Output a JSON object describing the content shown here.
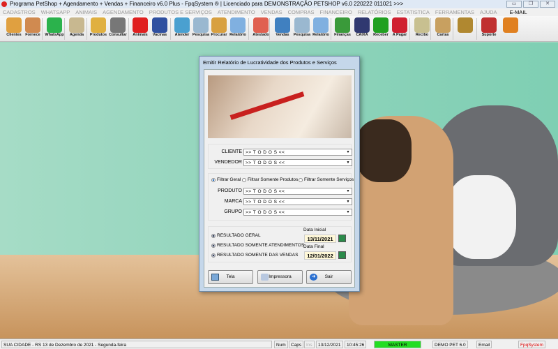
{
  "window": {
    "title": "Programa PetShop + Agendamento + Vendas + Financeiro v6.0 Plus - FpqSystem ® | Licenciado para  DEMONSTRAÇÃO PETSHOP v6.0 220222 011021 >>>"
  },
  "menu": [
    "CADASTROS",
    "WHATSAPP",
    "ANIMAIS",
    "AGENDAMENTO",
    "PRODUTOS E SERVIÇOS",
    "ATENDIMENTO",
    "VENDAS",
    "COMPRAS",
    "FINANCEIRO",
    "RELATÓRIOS",
    "ESTATISTICA",
    "FERRAMENTAS",
    "AJUDA",
    "E-MAIL"
  ],
  "toolbar": [
    {
      "label": "Clientes",
      "icon": "clients-icon",
      "color": "#e0a040"
    },
    {
      "label": "Fornece",
      "icon": "supplier-icon",
      "color": "#d08a50"
    },
    {
      "label": "WhatsApp",
      "icon": "whatsapp-icon",
      "color": "#2bb24c"
    },
    {
      "label": "Agenda",
      "icon": "agenda-icon",
      "color": "#c8b890"
    },
    {
      "label": "Produtos",
      "icon": "products-icon",
      "color": "#e0b040"
    },
    {
      "label": "Consultar",
      "icon": "barcode-icon",
      "color": "#777"
    },
    {
      "label": "Animais",
      "icon": "paw-icon",
      "color": "#e02020"
    },
    {
      "label": "Vacinas",
      "icon": "vaccine-icon",
      "color": "#3050a0"
    },
    {
      "label": "Atender",
      "icon": "paw-plus-icon",
      "color": "#4aa0d0"
    },
    {
      "label": "Pesquisa",
      "icon": "search-docs-icon",
      "color": "#9ab8d0"
    },
    {
      "label": "Procurar",
      "icon": "folder-icon",
      "color": "#d8a040"
    },
    {
      "label": "Relatório",
      "icon": "printer-icon",
      "color": "#80b0e0"
    },
    {
      "label": "Atestado",
      "icon": "certificate-icon",
      "color": "#e06050"
    },
    {
      "label": "Vendas",
      "icon": "monitor-icon",
      "color": "#4080c0"
    },
    {
      "label": "Pesquisa",
      "icon": "search-docs-icon",
      "color": "#9ab8d0"
    },
    {
      "label": "Relatório",
      "icon": "printer-icon",
      "color": "#80b0e0"
    },
    {
      "label": "Finanças",
      "icon": "finance-chart-icon",
      "color": "#3a9a3a"
    },
    {
      "label": "CAIXA",
      "icon": "cashbook-icon",
      "color": "#303870"
    },
    {
      "label": "Receber",
      "icon": "dollar-green-icon",
      "color": "#20a020"
    },
    {
      "label": "A Pagar",
      "icon": "dollar-red-icon",
      "color": "#d02030"
    },
    {
      "label": "Recibo",
      "icon": "receipt-icon",
      "color": "#c8c090"
    },
    {
      "label": "Cartas",
      "icon": "scroll-icon",
      "color": "#c8a060"
    },
    {
      "label": "",
      "icon": "coins-icon",
      "color": "#b08830"
    },
    {
      "label": "Suporte",
      "icon": "support-icon",
      "color": "#c03030"
    },
    {
      "label": "",
      "icon": "exit-door-icon",
      "color": "#e08020"
    }
  ],
  "dialog": {
    "title": "Emitir Relatório de Lucratividade dos Produtos e Serviços",
    "cliente_label": "CLIENTE",
    "cliente_value": ">> T O D O S <<",
    "vendedor_label": "VENDEDOR",
    "vendedor_value": ">> T O D O S <<",
    "filters": [
      "Filtrar Geral",
      "Filtrar Somente Produtos",
      "Filtrar Somente Serviços"
    ],
    "produto_label": "PRODUTO",
    "produto_value": ">> T O D O S <<",
    "marca_label": "MARCA",
    "marca_value": ">> T O D O S <<",
    "grupo_label": "GRUPO",
    "grupo_value": ">> T O D O S <<",
    "results": [
      "RESULTADO GERAL",
      "RESULTADO SOMENTE ATENDIMENTOS",
      "RESULTADO SOMENTE DAS VENDAS"
    ],
    "data_inicial_label": "Data Inicial",
    "data_inicial": "13/11/2021",
    "data_final_label": "Data Final",
    "data_final": "12/01/2022",
    "btn_tela": "Tela",
    "btn_impressora": "Impressora",
    "btn_sair": "Sair"
  },
  "status": {
    "city": "SUA CIDADE - RS 13 de Dezembro de 2021 - Segunda-feira",
    "num": "Num",
    "caps": "Caps",
    "ins": "Ins",
    "date": "13/12/2021",
    "time": "10:45:26",
    "user": "MASTER",
    "version": "DEMO PET 6.0",
    "email": "Email",
    "brand": "FpqSystem",
    "user_color": "#22dd22"
  }
}
